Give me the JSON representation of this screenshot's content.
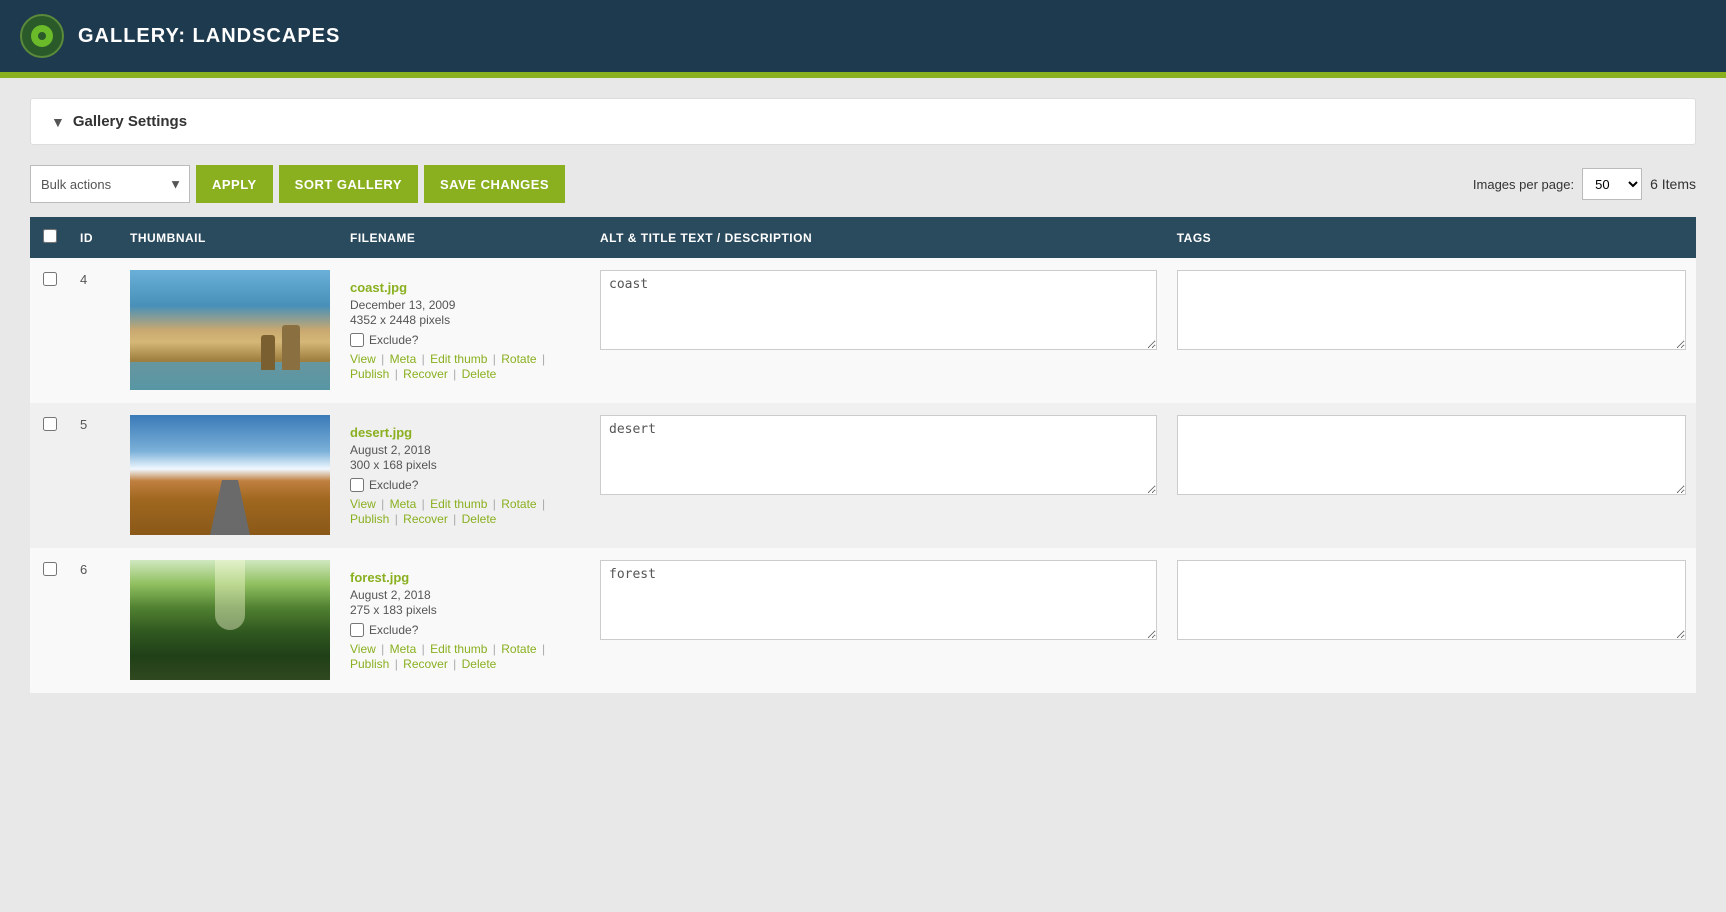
{
  "header": {
    "title": "GALLERY: LANDSCAPES",
    "logo_alt": "gallery-logo"
  },
  "settings": {
    "section_title": "Gallery Settings",
    "arrow": "▼"
  },
  "toolbar": {
    "bulk_actions_label": "Bulk actions",
    "apply_label": "APPLY",
    "sort_gallery_label": "SORT GALLERY",
    "save_changes_label": "SAVE CHANGES",
    "images_per_page_label": "Images per page:",
    "per_page_value": "50",
    "items_count": "6 Items"
  },
  "table": {
    "columns": [
      "",
      "ID",
      "THUMBNAIL",
      "FILENAME",
      "ALT & TITLE TEXT / DESCRIPTION",
      "TAGS"
    ],
    "rows": [
      {
        "id": "4",
        "filename": "coast.jpg",
        "date": "December 13, 2009",
        "dimensions": "4352 x 2448 pixels",
        "alt_text": "coast",
        "exclude_label": "Exclude?",
        "actions": [
          "View",
          "Meta",
          "Edit thumb",
          "Rotate",
          "Publish",
          "Recover",
          "Delete"
        ],
        "thumb_type": "coast"
      },
      {
        "id": "5",
        "filename": "desert.jpg",
        "date": "August 2, 2018",
        "dimensions": "300 x 168 pixels",
        "alt_text": "desert",
        "exclude_label": "Exclude?",
        "actions": [
          "View",
          "Meta",
          "Edit thumb",
          "Rotate",
          "Publish",
          "Recover",
          "Delete"
        ],
        "thumb_type": "desert"
      },
      {
        "id": "6",
        "filename": "forest.jpg",
        "date": "August 2, 2018",
        "dimensions": "275 x 183 pixels",
        "alt_text": "forest",
        "exclude_label": "Exclude?",
        "actions": [
          "View",
          "Meta",
          "Edit thumb",
          "Rotate",
          "Publish",
          "Recover",
          "Delete"
        ],
        "thumb_type": "forest"
      }
    ]
  },
  "colors": {
    "header_bg": "#1e3a4f",
    "accent_bar": "#8ab020",
    "table_header_bg": "#2a4a5e",
    "link_green": "#8ab020"
  }
}
